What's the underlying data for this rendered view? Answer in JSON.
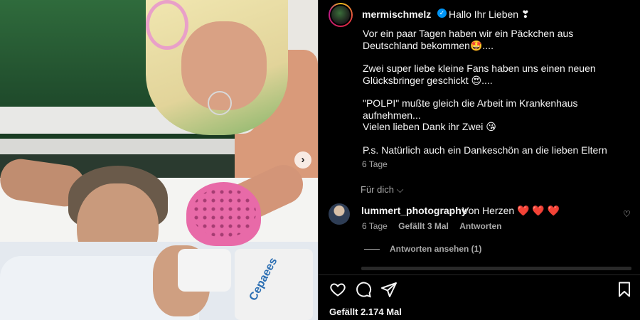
{
  "post": {
    "username": "mermischmelz",
    "verified_mark": "✓",
    "caption_first_line": "Hallo Ihr Lieben ❣",
    "caption": {
      "p1": "Vor ein paar Tagen haben wir ein Päckchen aus Deutschland bekommen🤩....",
      "p2": "Zwei super liebe kleine Fans haben uns einen neuen Glücksbringer geschickt 😍....",
      "p3": "\"POLPI\" mußte gleich die Arbeit im Krankenhaus aufnehmen...",
      "p4": "Vielen lieben Dank ihr Zwei 😘",
      "p5": "P.s. Natürlich auch ein Dankeschön an die lieben Eltern"
    },
    "time": "6 Tage",
    "translate_label": "Für dich ⌵",
    "likes": "Gefällt 2.174 Mal",
    "carousel_next": "›"
  },
  "photo": {
    "bed_text": "Cepaees"
  },
  "comment": {
    "username": "lummert_photography",
    "text": "Von Herzen",
    "hearts": "❤️ ❤️ ❤️",
    "time": "6 Tage",
    "likes": "Gefällt 3 Mal",
    "reply": "Antworten",
    "view_replies": "Antworten ansehen (1)",
    "like_icon": "♡"
  },
  "icons": {
    "heart": "heart-icon",
    "comment": "comment-icon",
    "share": "share-icon",
    "save": "bookmark-icon"
  },
  "colors": {
    "verified": "#0095f6",
    "heart_red": "#ed2d3d",
    "muted_text": "#a8a8a8"
  }
}
